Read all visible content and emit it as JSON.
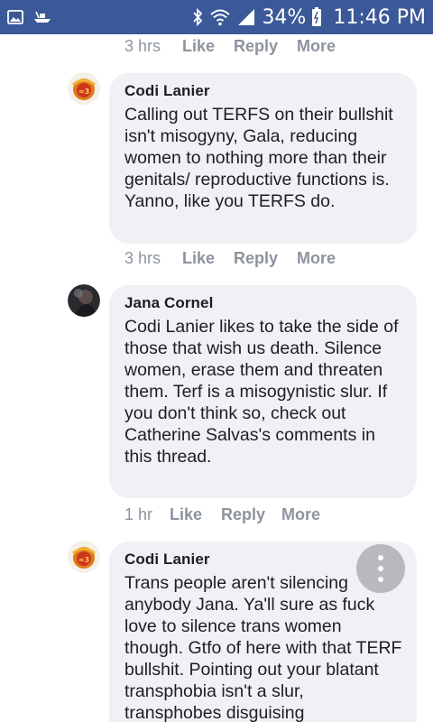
{
  "status_bar": {
    "battery_percent": "34%",
    "time": "11:46 PM",
    "icons": [
      "gallery-icon",
      "ship-icon",
      "bluetooth-icon",
      "wifi-icon",
      "signal-icon",
      "battery-icon"
    ]
  },
  "comment_actions": {
    "like": "Like",
    "reply": "Reply",
    "more": "More"
  },
  "top_action_time": "3 hrs",
  "comments": [
    {
      "author": "Codi Lanier",
      "text": "Calling out TERFS on their bullshit isn't misogyny, Gala, reducing women to nothing more than their genitals/ reproductive functions is. Yanno, like you TERFS do.",
      "time": "3 hrs"
    },
    {
      "author": "Jana Cornel",
      "text": "Codi Lanier likes to take the side of those that wish us death. Silence women, erase them and threaten them. Terf is a misogynistic slur. If you don't think so, check out Catherine Salvas's comments in this thread.",
      "time": "1 hr"
    },
    {
      "author": "Codi Lanier",
      "text": "Trans people aren't silencing anybody Jana. Ya'll sure as fuck love to silence trans women though. Gtfo of here with that TERF bullshit. Pointing out your blatant transphobia isn't a slur, transphobes disguising"
    }
  ],
  "colors": {
    "status_bar": "#3b5998",
    "bubble": "#f0f1f4",
    "meta_text": "#8d949e"
  }
}
